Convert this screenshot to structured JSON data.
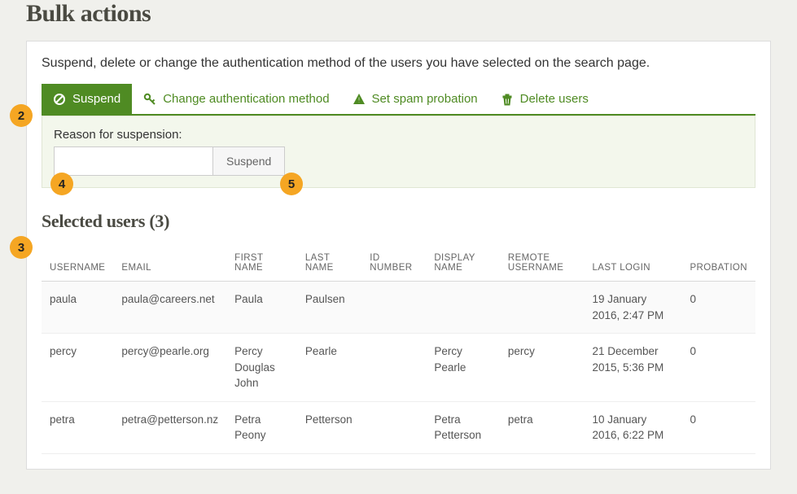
{
  "page": {
    "title": "Bulk actions",
    "intro": "Suspend, delete or change the authentication method of the users you have selected on the search page.",
    "selected_heading": "Selected users (3)"
  },
  "tabs": {
    "suspend": "Suspend",
    "change_auth": "Change authentication method",
    "spam": "Set spam probation",
    "delete": "Delete users"
  },
  "form": {
    "reason_label": "Reason for suspension:",
    "reason_value": "",
    "suspend_btn": "Suspend"
  },
  "table": {
    "headers": {
      "username": "USERNAME",
      "email": "EMAIL",
      "first_name": "FIRST NAME",
      "last_name": "LAST NAME",
      "id_number": "ID NUMBER",
      "display_name": "DISPLAY NAME",
      "remote_username": "REMOTE USERNAME",
      "last_login": "LAST LOGIN",
      "probation": "PROBATION"
    },
    "rows": [
      {
        "username": "paula",
        "email": "paula@careers.net",
        "first_name": "Paula",
        "last_name": "Paulsen",
        "id_number": "",
        "display_name": "",
        "remote_username": "",
        "last_login": "19 January 2016, 2:47 PM",
        "probation": "0"
      },
      {
        "username": "percy",
        "email": "percy@pearle.org",
        "first_name": "Percy Douglas John",
        "last_name": "Pearle",
        "id_number": "",
        "display_name": "Percy Pearle",
        "remote_username": "percy",
        "last_login": "21 December 2015, 5:36 PM",
        "probation": "0"
      },
      {
        "username": "petra",
        "email": "petra@petterson.nz",
        "first_name": "Petra Peony",
        "last_name": "Petterson",
        "id_number": "",
        "display_name": "Petra Petterson",
        "remote_username": "petra",
        "last_login": "10 January 2016, 6:22 PM",
        "probation": "0"
      }
    ]
  },
  "callouts": {
    "two": "2",
    "three": "3",
    "four": "4",
    "five": "5"
  }
}
